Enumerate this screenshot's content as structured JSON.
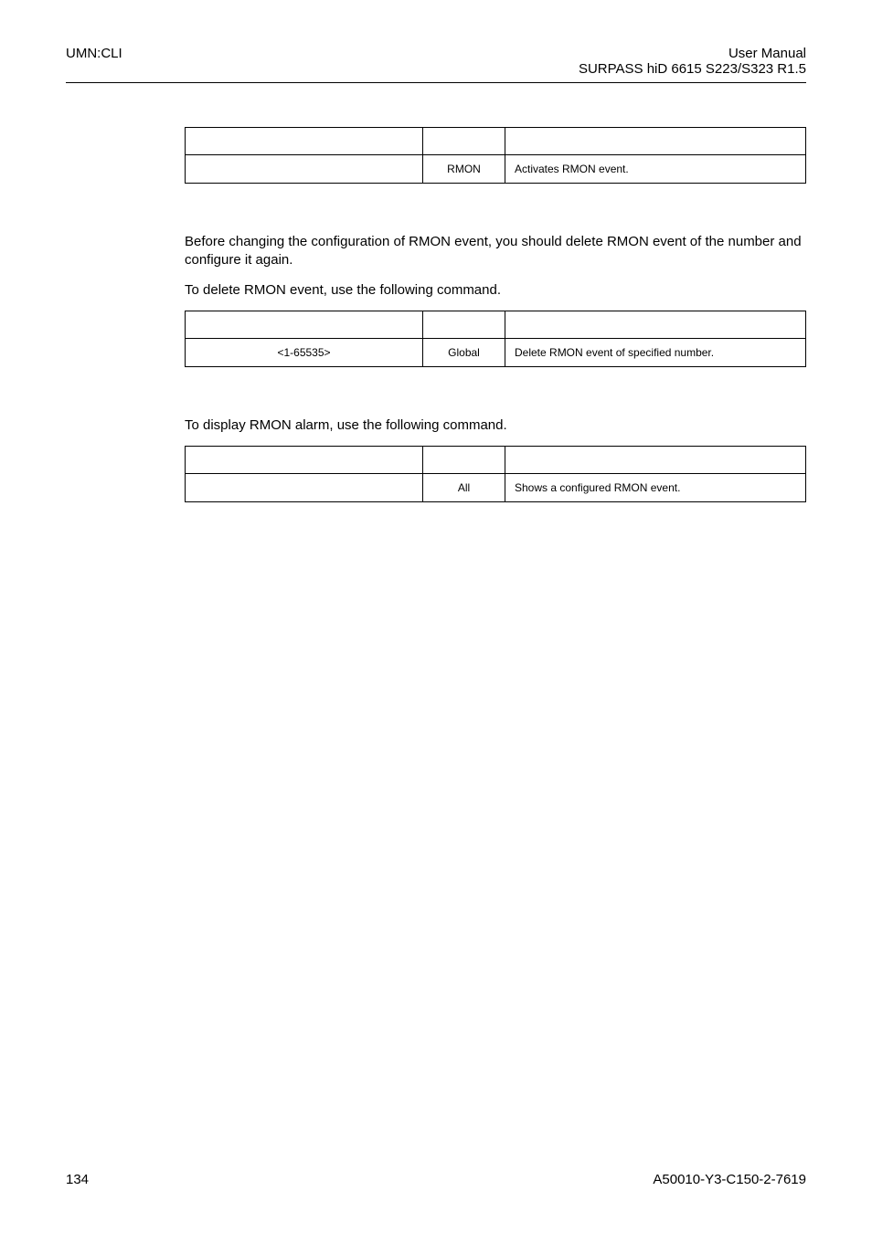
{
  "header": {
    "left": "UMN:CLI",
    "rightLine1": "User Manual",
    "rightLine2": "SURPASS hiD 6615 S223/S323 R1.5"
  },
  "table_activate": {
    "mode": "RMON",
    "desc": "Activates RMON event."
  },
  "para_delete_intro": "Before changing the configuration of RMON event, you should delete RMON event of the number and configure it again.",
  "para_delete_cmd": "To delete RMON event, use the following command.",
  "table_delete": {
    "cmd": "<1-65535>",
    "mode": "Global",
    "desc": "Delete RMON event of specified number."
  },
  "para_show_cmd": "To display RMON alarm, use the following command.",
  "table_show": {
    "mode": "All",
    "desc": "Shows a configured RMON event."
  },
  "footer": {
    "left": "134",
    "right": "A50010-Y3-C150-2-7619"
  }
}
